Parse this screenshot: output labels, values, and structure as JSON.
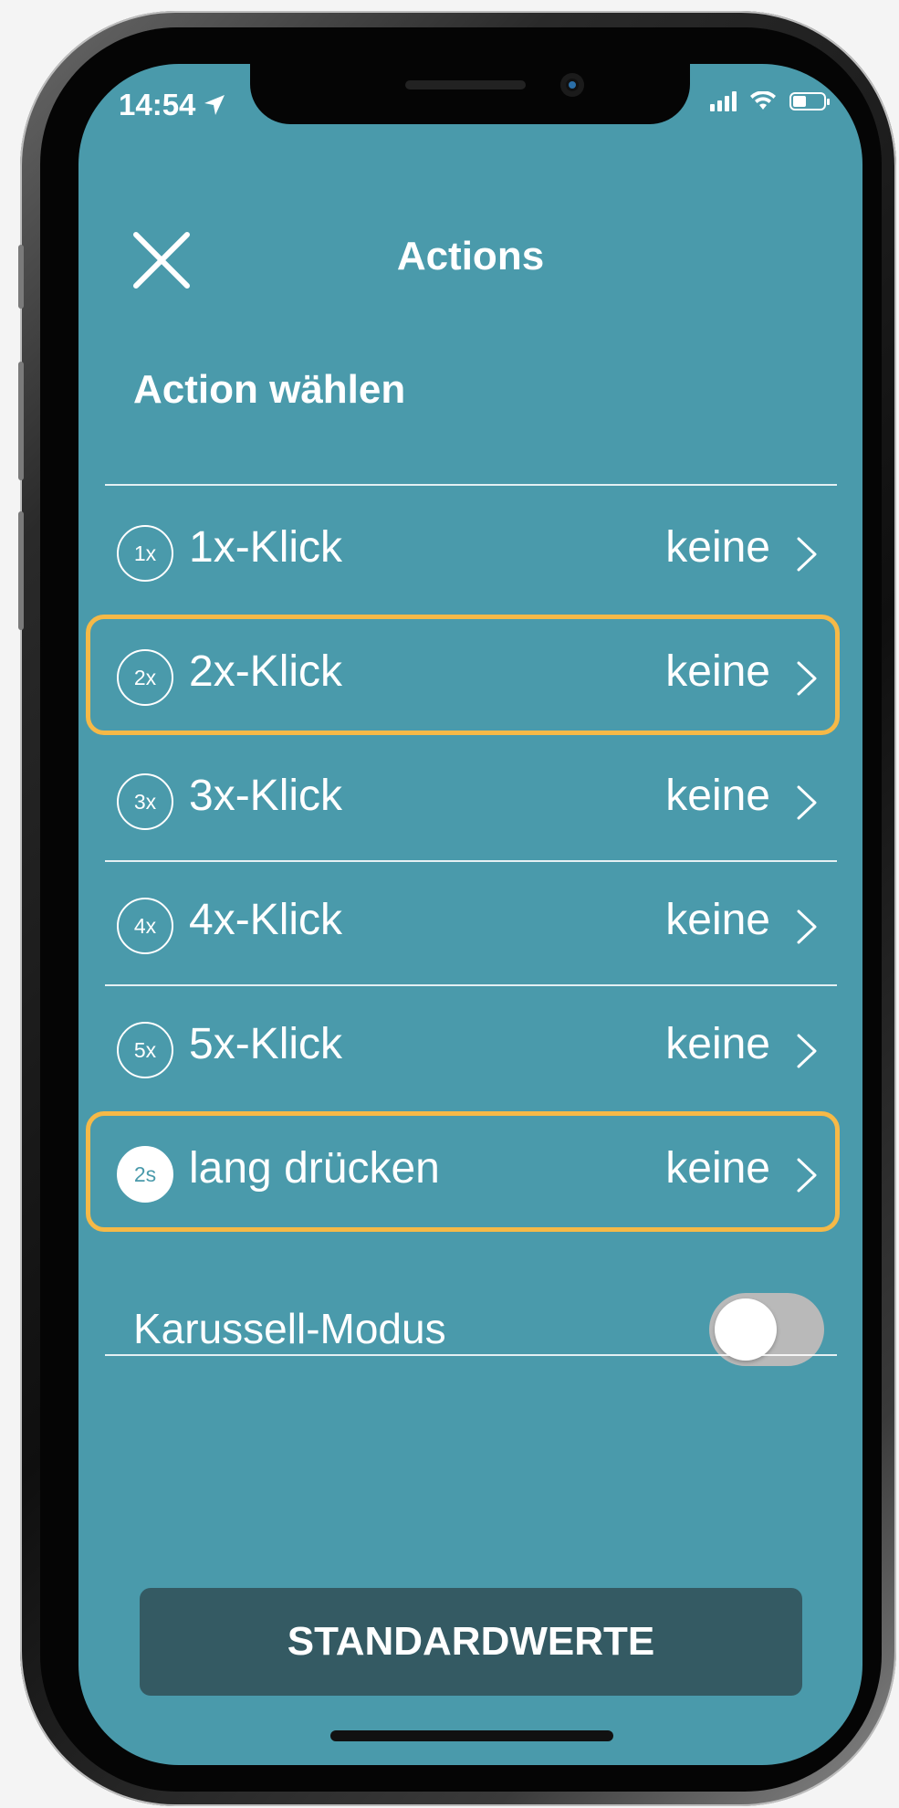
{
  "status_bar": {
    "time": "14:54",
    "signal_bars": 4,
    "battery_level_fraction": 0.45
  },
  "header": {
    "title": "Actions",
    "close_icon": "close-icon"
  },
  "section": {
    "title": "Action wählen"
  },
  "actions": [
    {
      "badge": "1x",
      "label": "1x-Klick",
      "value": "keine",
      "highlighted": false,
      "badge_filled": false
    },
    {
      "badge": "2x",
      "label": "2x-Klick",
      "value": "keine",
      "highlighted": true,
      "badge_filled": false
    },
    {
      "badge": "3x",
      "label": "3x-Klick",
      "value": "keine",
      "highlighted": false,
      "badge_filled": false
    },
    {
      "badge": "4x",
      "label": "4x-Klick",
      "value": "keine",
      "highlighted": false,
      "badge_filled": false
    },
    {
      "badge": "5x",
      "label": "5x-Klick",
      "value": "keine",
      "highlighted": false,
      "badge_filled": false
    },
    {
      "badge": "2s",
      "label": "lang drücken",
      "value": "keine",
      "highlighted": true,
      "badge_filled": true
    }
  ],
  "carousel": {
    "label": "Karussell-Modus",
    "enabled": false
  },
  "footer": {
    "button_label": "STANDARDWERTE"
  },
  "colors": {
    "screen_background": "#4a9aab",
    "highlight_border": "#f6b947",
    "button_background": "#345a63",
    "toggle_off": "#b9b9b9"
  }
}
